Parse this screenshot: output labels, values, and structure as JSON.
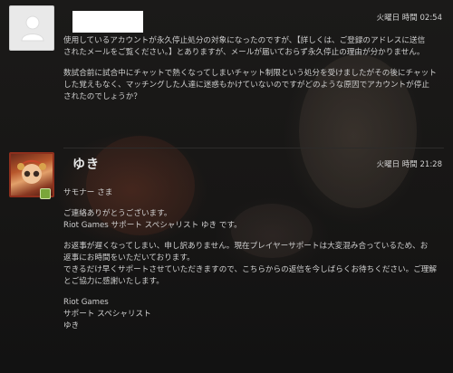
{
  "messages": [
    {
      "author": "",
      "timestamp": "火曜日 時間 02:54",
      "paragraphs": [
        [
          "使用しているアカウントが永久停止処分の対象になったのですが、【詳しくは、ご登録のアドレスに送信",
          "されたメールをご覧ください。】とありますが、メールが届いておらず永久停止の理由が分かりません。"
        ],
        [
          "数試合前に試合中にチャットで熱くなってしまいチャット制限という処分を受けましたがその後にチャット",
          "した覚えもなく、マッチングした人達に迷惑もかけていないのですがどのような原因でアカウントが停止",
          "されたのでしょうか？"
        ]
      ]
    },
    {
      "author": "ゆき",
      "timestamp": "火曜日 時間 21:28",
      "paragraphs": [
        [
          "サモナー さま"
        ],
        [
          "ご連絡ありがとうございます。",
          "Riot Games サポート スペシャリスト ゆき です。"
        ],
        [
          "お返事が遅くなってしまい、申し訳ありません。現在プレイヤーサポートは大変混み合っているため、お",
          "返事にお時間をいただいております。",
          "できるだけ早くサポートさせていただきますので、こちらからの返信を今しばらくお待ちください。ご理解",
          "とご協力に感謝いたします。"
        ],
        [
          "Riot Games",
          "サポート スペシャリスト",
          "ゆき"
        ]
      ]
    }
  ]
}
